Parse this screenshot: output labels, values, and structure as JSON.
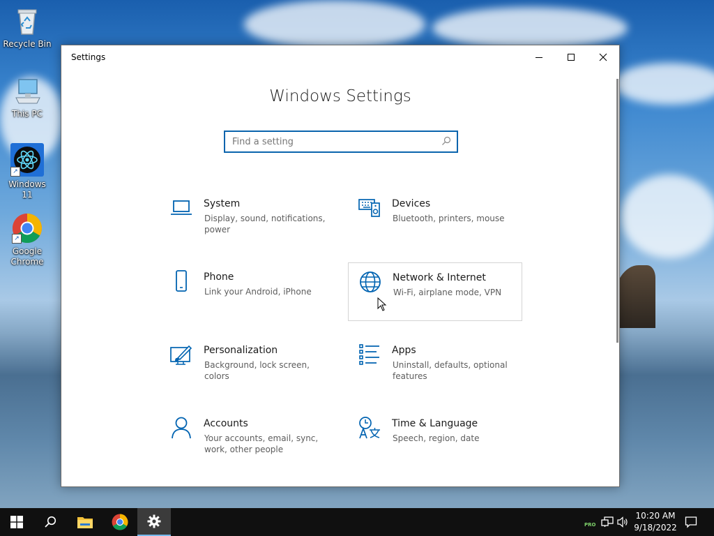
{
  "desktop": {
    "icons": [
      {
        "label": "Recycle Bin",
        "icon": "recycle-bin-icon"
      },
      {
        "label": "This PC",
        "icon": "computer-icon"
      },
      {
        "label": "Windows 11",
        "icon": "react-app-icon"
      },
      {
        "label": "Google Chrome",
        "icon": "chrome-icon"
      }
    ]
  },
  "window": {
    "title": "Settings",
    "controls": [
      "minimize-icon",
      "maximize-icon",
      "close-icon"
    ],
    "heading": "Windows Settings",
    "search": {
      "placeholder": "Find a setting",
      "value": ""
    },
    "tiles": [
      {
        "title": "System",
        "desc": "Display, sound, notifications, power",
        "icon": "laptop-icon"
      },
      {
        "title": "Devices",
        "desc": "Bluetooth, printers, mouse",
        "icon": "keyboard-speaker-icon"
      },
      {
        "title": "Phone",
        "desc": "Link your Android, iPhone",
        "icon": "phone-icon"
      },
      {
        "title": "Network & Internet",
        "desc": "Wi-Fi, airplane mode, VPN",
        "icon": "globe-icon"
      },
      {
        "title": "Personalization",
        "desc": "Background, lock screen, colors",
        "icon": "paint-brush-icon"
      },
      {
        "title": "Apps",
        "desc": "Uninstall, defaults, optional features",
        "icon": "apps-list-icon"
      },
      {
        "title": "Accounts",
        "desc": "Your accounts, email, sync, work, other people",
        "icon": "person-icon"
      },
      {
        "title": "Time & Language",
        "desc": "Speech, region, date",
        "icon": "time-language-icon"
      }
    ]
  },
  "taskbar": {
    "items": [
      "windows-start-icon",
      "search-icon",
      "file-explorer-icon",
      "chrome-icon",
      "settings-gear-icon"
    ],
    "tray": {
      "badge": "PRO"
    },
    "clock": {
      "time": "10:20 AM",
      "date": "9/18/2022"
    }
  },
  "colors": {
    "accent": "#0063b1",
    "search_border": "#0a64ad",
    "taskbar": "#101010"
  }
}
